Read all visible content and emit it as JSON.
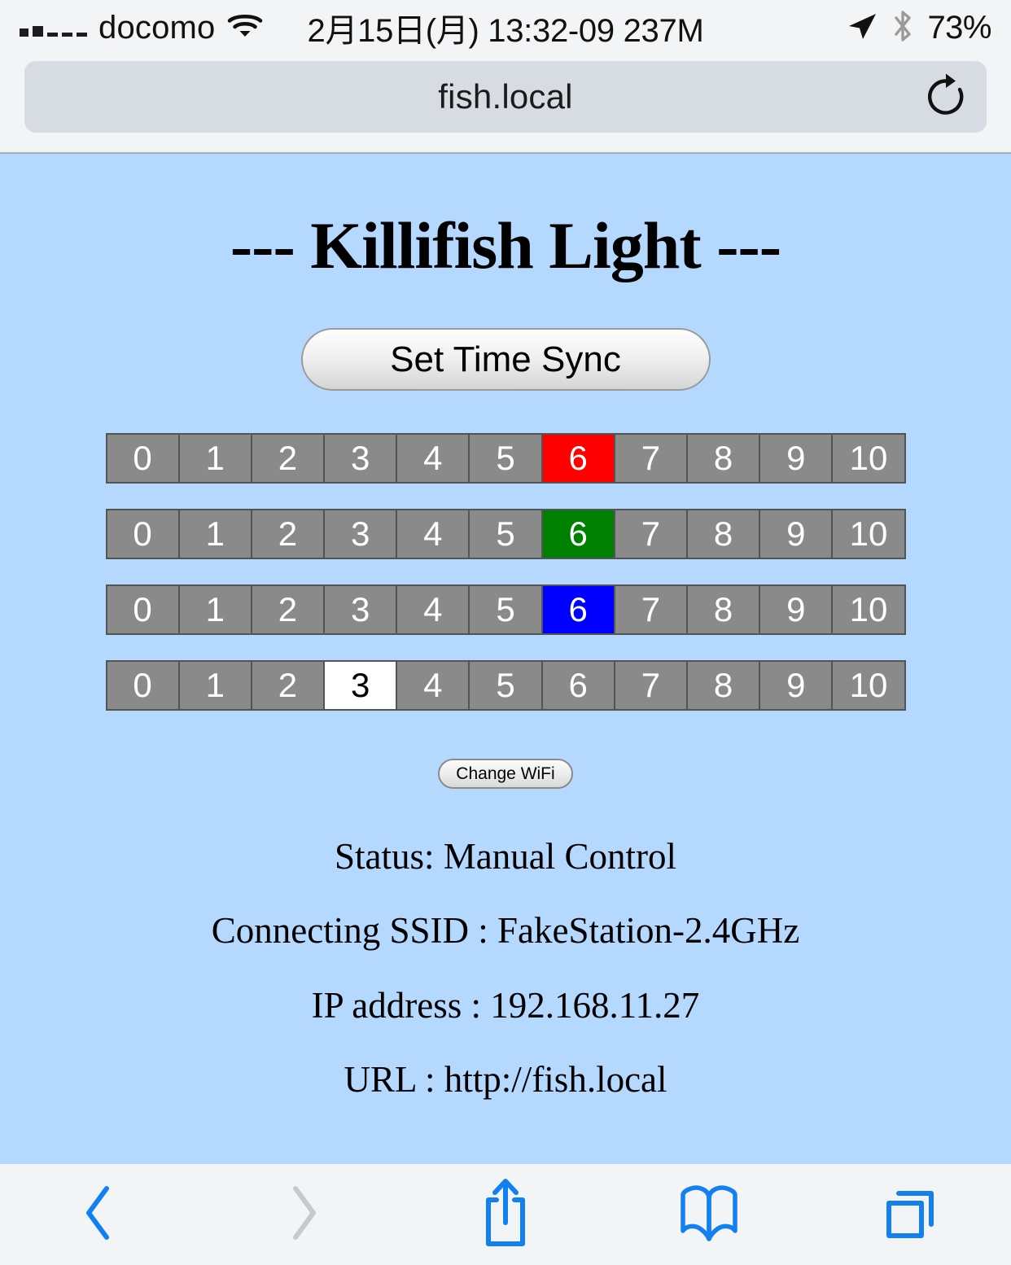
{
  "statusbar": {
    "carrier": "docomo",
    "signal_bars": [
      true,
      true,
      false,
      false,
      false
    ],
    "wifi_icon": "wifi-icon",
    "clock": "2月15日(月) 13:32-09 237M",
    "location_icon": "location-arrow-icon",
    "bluetooth_icon": "bluetooth-icon",
    "battery": "73%"
  },
  "browser": {
    "url": "fish.local",
    "reload_icon": "reload-icon",
    "toolbar": {
      "back_icon": "chevron-left-icon",
      "forward_icon": "chevron-right-icon",
      "share_icon": "share-icon",
      "bookmarks_icon": "book-icon",
      "tabs_icon": "tabs-icon"
    }
  },
  "page": {
    "title": "--- Killifish Light ---",
    "sync_button": "Set Time Sync",
    "wifi_button": "Change WiFi",
    "background_color": "#b5d8ff",
    "sliders": [
      {
        "name": "red-channel",
        "color": "#ff0000",
        "selected": 6,
        "values": [
          "0",
          "1",
          "2",
          "3",
          "4",
          "5",
          "6",
          "7",
          "8",
          "9",
          "10"
        ]
      },
      {
        "name": "green-channel",
        "color": "#008000",
        "selected": 6,
        "values": [
          "0",
          "1",
          "2",
          "3",
          "4",
          "5",
          "6",
          "7",
          "8",
          "9",
          "10"
        ]
      },
      {
        "name": "blue-channel",
        "color": "#0000ff",
        "selected": 6,
        "values": [
          "0",
          "1",
          "2",
          "3",
          "4",
          "5",
          "6",
          "7",
          "8",
          "9",
          "10"
        ]
      },
      {
        "name": "white-channel",
        "color": "#ffffff",
        "selected": 3,
        "values": [
          "0",
          "1",
          "2",
          "3",
          "4",
          "5",
          "6",
          "7",
          "8",
          "9",
          "10"
        ]
      }
    ],
    "info": {
      "status": "Status: Manual Control",
      "ssid": "Connecting SSID : FakeStation-2.4GHz",
      "ip": "IP address : 192.168.11.27",
      "url": "URL : http://fish.local"
    }
  }
}
